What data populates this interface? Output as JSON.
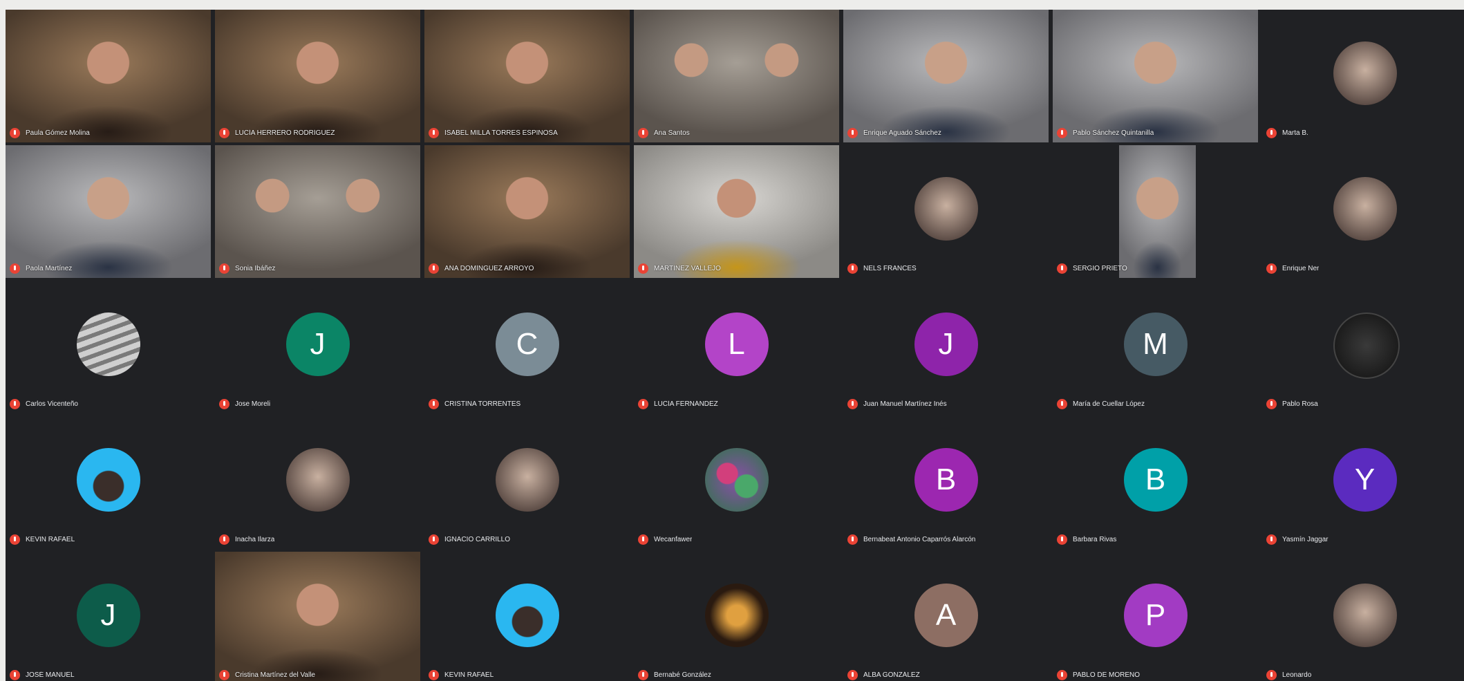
{
  "colors": {
    "background": "#202124",
    "muted_mic": "#ea4335",
    "active_speaker": "#4fc3a1",
    "avatars": {
      "J_green": "#0b8566",
      "C_gray": "#7b8c96",
      "L_purple": "#b344c8",
      "J_purple": "#8e24aa",
      "M_slate": "#465a64",
      "B_purple": "#9c27b0",
      "B_teal": "#00a0a8",
      "Y_violet": "#5b2bbf",
      "J_darkgreen": "#0d5c4a",
      "A_brown": "#8d6e63",
      "P_magenta": "#a23bc3"
    }
  },
  "participants": [
    {
      "name": "Paula Gómez Molina",
      "kind": "camera",
      "tone": "warm"
    },
    {
      "name": "LUCÍA HERRERO RODRÍGUEZ",
      "kind": "camera",
      "tone": "warm"
    },
    {
      "name": "ISABEL MILLA TORRES ESPINOSA",
      "kind": "camera",
      "tone": "warm"
    },
    {
      "name": "Ana Santos",
      "kind": "camera",
      "tone": "split"
    },
    {
      "name": "Enrique Aguado Sánchez",
      "kind": "camera",
      "tone": "cool"
    },
    {
      "name": "Pablo Sánchez Quintanilla",
      "kind": "camera",
      "tone": "cool",
      "active": true
    },
    {
      "name": "Marta B.",
      "kind": "avatar",
      "avatar": "photo"
    },
    {
      "name": "Paola Martínez",
      "kind": "camera",
      "tone": "cool"
    },
    {
      "name": "Sonia Ibáñez",
      "kind": "camera",
      "tone": "split"
    },
    {
      "name": "ANA DOMÍNGUEZ ARROYO",
      "kind": "camera",
      "tone": "warm"
    },
    {
      "name": "MARTÍNEZ VALLEJO",
      "kind": "camera",
      "tone": "yellow"
    },
    {
      "name": "NELS FRANCES",
      "kind": "avatar",
      "avatar": "photo"
    },
    {
      "name": "SERGIO PRIETO",
      "kind": "camera",
      "tone": "cool",
      "narrow": true
    },
    {
      "name": "Enrique Ner",
      "kind": "avatar",
      "avatar": "photo"
    },
    {
      "name": "Carlos Vicenteño",
      "kind": "avatar",
      "avatar": "waves"
    },
    {
      "name": "Jose Moreli",
      "kind": "avatar",
      "initial": "J",
      "color": "#0b8566"
    },
    {
      "name": "CRISTINA TORRENTES",
      "kind": "avatar",
      "initial": "C",
      "color": "#7b8c96"
    },
    {
      "name": "LUCÍA FERNÁNDEZ",
      "kind": "avatar",
      "initial": "L",
      "color": "#b344c8"
    },
    {
      "name": "Juan Manuel Martínez Inés",
      "kind": "avatar",
      "initial": "J",
      "color": "#8e24aa"
    },
    {
      "name": "María de Cuellar López",
      "kind": "avatar",
      "initial": "M",
      "color": "#465a64"
    },
    {
      "name": "Pablo Rosa",
      "kind": "avatar",
      "avatar": "dark"
    },
    {
      "name": "KEVIN RAFAEL",
      "kind": "avatar",
      "avatar": "blue"
    },
    {
      "name": "Inacha Ilarza",
      "kind": "avatar",
      "avatar": "photo"
    },
    {
      "name": "IGNACIO CARRILLO",
      "kind": "avatar",
      "avatar": "photo"
    },
    {
      "name": "Wecanfawer",
      "kind": "avatar",
      "avatar": "flowers"
    },
    {
      "name": "Bernabeat Antonio Caparrós Alarcón",
      "kind": "avatar",
      "initial": "B",
      "color": "#9c27b0"
    },
    {
      "name": "Barbara Rivas",
      "kind": "avatar",
      "initial": "B",
      "color": "#00a0a8"
    },
    {
      "name": "Yasmín Jaggar",
      "kind": "avatar",
      "initial": "Y",
      "color": "#5b2bbf"
    },
    {
      "name": "JOSÉ MANUEL",
      "kind": "avatar",
      "initial": "J",
      "color": "#0d5c4a"
    },
    {
      "name": "Cristina Martínez del Valle",
      "kind": "camera",
      "tone": "warm"
    },
    {
      "name": "KEVIN RAFAEL",
      "kind": "avatar",
      "avatar": "blue"
    },
    {
      "name": "Bernabé González",
      "kind": "avatar",
      "avatar": "fire"
    },
    {
      "name": "ALBA GONZÁLEZ",
      "kind": "avatar",
      "initial": "A",
      "color": "#8d6e63"
    },
    {
      "name": "PABLO DE MORENO",
      "kind": "avatar",
      "initial": "P",
      "color": "#a23bc3"
    },
    {
      "name": "Leonardo",
      "kind": "avatar",
      "avatar": "photo"
    }
  ]
}
